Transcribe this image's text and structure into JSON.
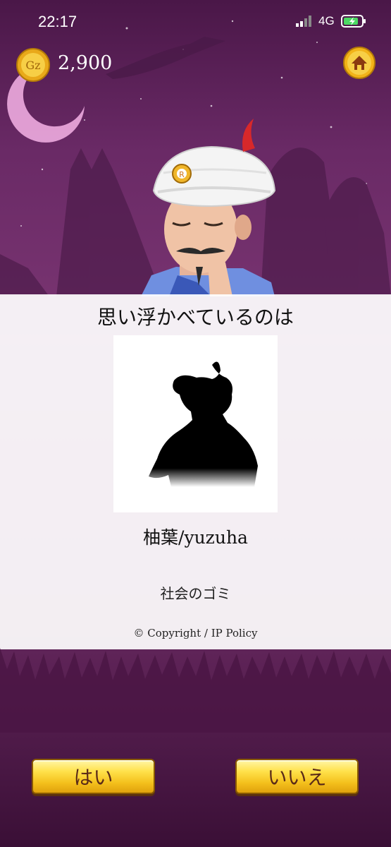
{
  "status": {
    "time": "22:17",
    "network": "4G"
  },
  "header": {
    "coins": "2,900",
    "coin_label": "Gz"
  },
  "result": {
    "headline": "思い浮かべているのは",
    "name": "柚葉/yuzuha",
    "description": "社会のゴミ",
    "copyright": "© Copyright / IP Policy"
  },
  "buttons": {
    "yes": "はい",
    "no": "いいえ"
  },
  "colors": {
    "background": "#6a2a66",
    "gold": "#f4c01c",
    "panel": "#ffffff"
  },
  "icons": [
    "coin-icon",
    "home-icon",
    "signal-icon",
    "battery-icon",
    "silhouette-image",
    "genie-character"
  ]
}
